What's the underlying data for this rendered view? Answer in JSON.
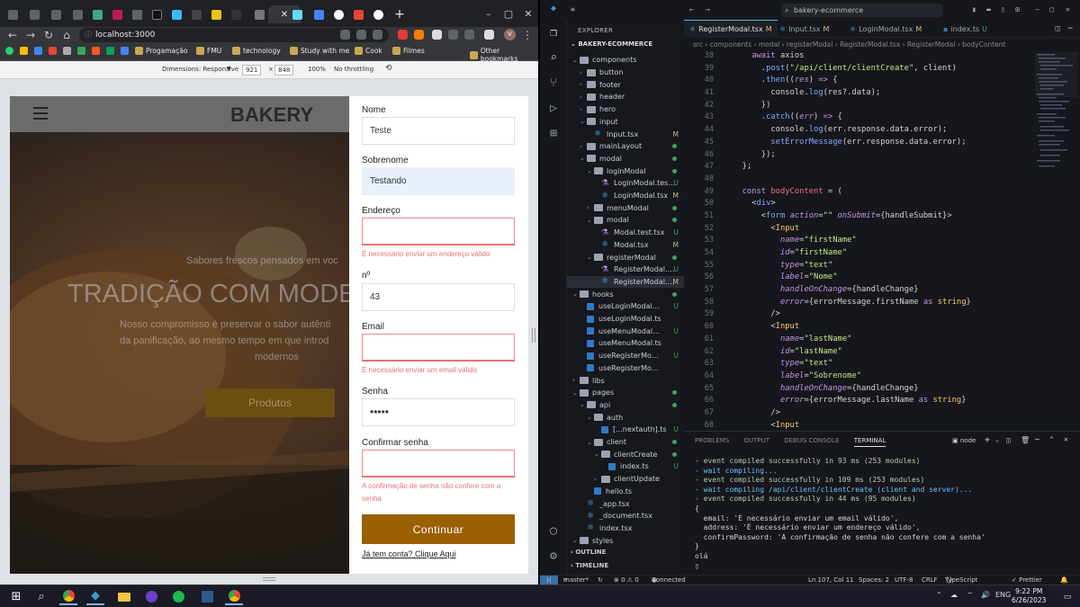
{
  "browser": {
    "url": "localhost:3000",
    "bookmarks": [
      "Progamação",
      "FMU",
      "technology",
      "Study with me",
      "Cook",
      "Filmes",
      "Other bookmarks"
    ],
    "devtools": {
      "dimensions_label": "Dimensions: Responsive",
      "width": "921",
      "times": "×",
      "height": "848",
      "zoom": "100%",
      "throttle": "No throttling"
    },
    "avatar_letter": "V"
  },
  "site": {
    "logo": "BAKERY",
    "hero_subtitle": "Sabores frescos pensados em voc",
    "hero_title": "TRADIÇÃO COM MODE",
    "hero_text_1": "Nosso compromisso é preservar o sabor autênti",
    "hero_text_2": "da panificação, ao mesmo tempo em que introd",
    "hero_text_3": "modernos",
    "hero_button": "Produtos"
  },
  "form": {
    "nome_label": "Nome",
    "nome_value": "Teste",
    "sobrenome_label": "Sobrenome",
    "sobrenome_value": "Testando",
    "endereco_label": "Endereço",
    "endereco_error": "É necessário enviar um endereço válido",
    "numero_label": "nº",
    "numero_value": "43",
    "email_label": "Email",
    "email_error": "É necessário enviar um email válido",
    "senha_label": "Senha",
    "senha_value": "•••••",
    "confirmar_label": "Confirmar senha",
    "confirmar_error": "A confirmação de senha não confere com a senha",
    "submit": "Continuar",
    "login_link": "Já tem conta? Clique Aqui"
  },
  "vscode": {
    "search": "bakery-ecommerce",
    "explorer_title": "EXPLORER",
    "project": "BAKERY-ECOMMERCE",
    "tree": [
      {
        "label": "components",
        "indent": 1,
        "kind": "folder",
        "open": true
      },
      {
        "label": "button",
        "indent": 2,
        "kind": "folder",
        "open": false
      },
      {
        "label": "footer",
        "indent": 2,
        "kind": "folder",
        "open": false
      },
      {
        "label": "header",
        "indent": 2,
        "kind": "folder",
        "open": false
      },
      {
        "label": "hero",
        "indent": 2,
        "kind": "folder",
        "open": false
      },
      {
        "label": "input",
        "indent": 2,
        "kind": "folder",
        "open": true
      },
      {
        "label": "Input.tsx",
        "indent": 3,
        "kind": "react",
        "status": "M"
      },
      {
        "label": "mainLayout",
        "indent": 2,
        "kind": "folder",
        "open": false,
        "dot": true
      },
      {
        "label": "modal",
        "indent": 2,
        "kind": "folder",
        "open": true,
        "dot": true
      },
      {
        "label": "loginModal",
        "indent": 3,
        "kind": "folder",
        "open": true,
        "dot": true
      },
      {
        "label": "LoginModal.test.tsx",
        "indent": 4,
        "kind": "test",
        "status": "U"
      },
      {
        "label": "LoginModal.tsx",
        "indent": 4,
        "kind": "react",
        "status": "M"
      },
      {
        "label": "menuModal",
        "indent": 3,
        "kind": "folder",
        "open": false,
        "dot": true
      },
      {
        "label": "modal",
        "indent": 3,
        "kind": "folder",
        "open": true,
        "dot": true
      },
      {
        "label": "Modal.test.tsx",
        "indent": 4,
        "kind": "test",
        "status": "U"
      },
      {
        "label": "Modal.tsx",
        "indent": 4,
        "kind": "react",
        "status": "M"
      },
      {
        "label": "registerModal",
        "indent": 3,
        "kind": "folder",
        "open": true,
        "dot": true
      },
      {
        "label": "RegisterModal.test.tsx",
        "indent": 4,
        "kind": "test",
        "status": "U"
      },
      {
        "label": "RegisterModal.tsx",
        "indent": 4,
        "kind": "react",
        "status": "M",
        "selected": true
      },
      {
        "label": "hooks",
        "indent": 1,
        "kind": "folder",
        "open": true,
        "dot": true
      },
      {
        "label": "useLoginModal.test.ts",
        "indent": 2,
        "kind": "ts",
        "status": "U"
      },
      {
        "label": "useLoginModal.ts",
        "indent": 2,
        "kind": "ts"
      },
      {
        "label": "useMenuModal.test.ts",
        "indent": 2,
        "kind": "ts",
        "status": "U"
      },
      {
        "label": "useMenuModal.ts",
        "indent": 2,
        "kind": "ts"
      },
      {
        "label": "useRegisterModal.test.ts",
        "indent": 2,
        "kind": "ts",
        "status": "U"
      },
      {
        "label": "useRegisterModal.ts",
        "indent": 2,
        "kind": "ts"
      },
      {
        "label": "libs",
        "indent": 1,
        "kind": "folder",
        "open": false
      },
      {
        "label": "pages",
        "indent": 1,
        "kind": "folder",
        "open": true,
        "dot": true
      },
      {
        "label": "api",
        "indent": 2,
        "kind": "folder",
        "open": true,
        "dot": true
      },
      {
        "label": "auth",
        "indent": 3,
        "kind": "folder",
        "open": true
      },
      {
        "label": "[...nextauth].ts",
        "indent": 4,
        "kind": "ts",
        "status": "U"
      },
      {
        "label": "client",
        "indent": 3,
        "kind": "folder",
        "open": true,
        "dot": true
      },
      {
        "label": "clientCreate",
        "indent": 4,
        "kind": "folder",
        "open": true,
        "dot": true
      },
      {
        "label": "index.ts",
        "indent": 5,
        "kind": "ts",
        "status": "U"
      },
      {
        "label": "clientUpdate",
        "indent": 4,
        "kind": "folder",
        "open": false
      },
      {
        "label": "hello.ts",
        "indent": 3,
        "kind": "ts"
      },
      {
        "label": "_app.tsx",
        "indent": 2,
        "kind": "react"
      },
      {
        "label": "_document.tsx",
        "indent": 2,
        "kind": "react"
      },
      {
        "label": "index.tsx",
        "indent": 2,
        "kind": "react"
      },
      {
        "label": "styles",
        "indent": 1,
        "kind": "folder",
        "open": true
      }
    ],
    "outline": "OUTLINE",
    "timeline": "TIMELINE",
    "tabs": [
      {
        "label": "RegisterModal.tsx",
        "status": "M",
        "active": true
      },
      {
        "label": "Input.tsx",
        "status": "M"
      },
      {
        "label": "LoginModal.tsx",
        "status": "M"
      },
      {
        "label": "index.ts",
        "status": "U"
      }
    ],
    "breadcrumb": "src › components › modal › registerModal › RegisterModal.tsx › RegisterModal › bodyContent",
    "code_start": 38,
    "code": [
      [
        [
          "pl",
          "    "
        ],
        [
          "kw",
          "await "
        ],
        [
          "pl",
          "axios"
        ]
      ],
      [
        [
          "pl",
          "      ."
        ],
        [
          "fn",
          "post"
        ],
        [
          "pl",
          "("
        ],
        [
          "str",
          "\"/api/client/clientCreate\""
        ],
        [
          "pl",
          ", client)"
        ]
      ],
      [
        [
          "pl",
          "      ."
        ],
        [
          "fn",
          "then"
        ],
        [
          "pl",
          "(("
        ],
        [
          "at",
          "res"
        ],
        [
          "pl",
          ") "
        ],
        [
          "kw",
          "=>"
        ],
        [
          "pl",
          " {"
        ]
      ],
      [
        [
          "pl",
          "        console."
        ],
        [
          "fn",
          "log"
        ],
        [
          "pl",
          "(res?.data);"
        ]
      ],
      [
        [
          "pl",
          "      })"
        ]
      ],
      [
        [
          "pl",
          "      ."
        ],
        [
          "fn",
          "catch"
        ],
        [
          "pl",
          "(("
        ],
        [
          "at",
          "err"
        ],
        [
          "pl",
          ") "
        ],
        [
          "kw",
          "=>"
        ],
        [
          "pl",
          " {"
        ]
      ],
      [
        [
          "pl",
          "        console."
        ],
        [
          "fn",
          "log"
        ],
        [
          "pl",
          "(err.response.data.error);"
        ]
      ],
      [
        [
          "pl",
          "        "
        ],
        [
          "fn",
          "setErrorMessage"
        ],
        [
          "pl",
          "(err.response.data.error);"
        ]
      ],
      [
        [
          "pl",
          "      });"
        ]
      ],
      [
        [
          "pl",
          "  };"
        ]
      ],
      [
        [
          "pl",
          ""
        ]
      ],
      [
        [
          "kw",
          "  const "
        ],
        [
          "vr",
          "bodyContent"
        ],
        [
          "pl",
          " = ("
        ]
      ],
      [
        [
          "pl",
          "    <"
        ],
        [
          "tg",
          "div"
        ],
        [
          "pl",
          ">"
        ]
      ],
      [
        [
          "pl",
          "      <"
        ],
        [
          "tg",
          "form "
        ],
        [
          "at",
          "action"
        ],
        [
          "pl",
          "="
        ],
        [
          "str",
          "\"\" "
        ],
        [
          "at",
          "onSubmit"
        ],
        [
          "pl",
          "={handleSubmit}>"
        ]
      ],
      [
        [
          "pl",
          "        <"
        ],
        [
          "ty",
          "Input"
        ]
      ],
      [
        [
          "at",
          "          name"
        ],
        [
          "pl",
          "="
        ],
        [
          "str",
          "\"firstName\""
        ]
      ],
      [
        [
          "at",
          "          id"
        ],
        [
          "pl",
          "="
        ],
        [
          "str",
          "\"firstName\""
        ]
      ],
      [
        [
          "at",
          "          type"
        ],
        [
          "pl",
          "="
        ],
        [
          "str",
          "\"text\""
        ]
      ],
      [
        [
          "at",
          "          label"
        ],
        [
          "pl",
          "="
        ],
        [
          "str",
          "\"Nome\""
        ]
      ],
      [
        [
          "at",
          "          handleOnChange"
        ],
        [
          "pl",
          "={handleChange}"
        ]
      ],
      [
        [
          "at",
          "          error"
        ],
        [
          "pl",
          "={errorMessage.firstName "
        ],
        [
          "kw",
          "as "
        ],
        [
          "ty",
          "string"
        ],
        [
          "pl",
          "}"
        ]
      ],
      [
        [
          "pl",
          "        />"
        ]
      ],
      [
        [
          "pl",
          "        <"
        ],
        [
          "ty",
          "Input"
        ]
      ],
      [
        [
          "at",
          "          name"
        ],
        [
          "pl",
          "="
        ],
        [
          "str",
          "\"lastName\""
        ]
      ],
      [
        [
          "at",
          "          id"
        ],
        [
          "pl",
          "="
        ],
        [
          "str",
          "\"lastName\""
        ]
      ],
      [
        [
          "at",
          "          type"
        ],
        [
          "pl",
          "="
        ],
        [
          "str",
          "\"text\""
        ]
      ],
      [
        [
          "at",
          "          label"
        ],
        [
          "pl",
          "="
        ],
        [
          "str",
          "\"Sobrenome\""
        ]
      ],
      [
        [
          "at",
          "          handleOnChange"
        ],
        [
          "pl",
          "={handleChange}"
        ]
      ],
      [
        [
          "at",
          "          error"
        ],
        [
          "pl",
          "={errorMessage.lastName "
        ],
        [
          "kw",
          "as "
        ],
        [
          "ty",
          "string"
        ],
        [
          "pl",
          "}"
        ]
      ],
      [
        [
          "pl",
          "        />"
        ]
      ],
      [
        [
          "pl",
          "        <"
        ],
        [
          "ty",
          "Input"
        ]
      ]
    ],
    "panel_tabs": [
      "PROBLEMS",
      "OUTPUT",
      "DEBUG CONSOLE",
      "TERMINAL"
    ],
    "terminal_shell": "node",
    "terminal": [
      "- event compiled successfully in 93 ms (253 modules)",
      "- wait compiling...",
      "- event compiled successfully in 109 ms (253 modules)",
      "- wait compiling /api/client/clientCreate (client and server)...",
      "- event compiled successfully in 44 ms (95 modules)",
      "{",
      "  email: 'É necessário enviar um email válido',",
      "  address: 'É necessário enviar um endereço válido',",
      "  confirmPassword: 'A confirmação de senha não confere com a senha'",
      "}",
      "olá",
      "▯"
    ],
    "status": {
      "branch": "master*",
      "problems": "⊗ 0 ⚠ 0",
      "discord": "Connected to Discord",
      "position": "Ln 107, Col 11",
      "spaces": "Spaces: 2",
      "encoding": "UTF-8",
      "eol": "CRLF",
      "language": "TypeScript JSX",
      "prettier": "✓ Prettier"
    }
  },
  "taskbar": {
    "lang": "ENG",
    "time": "9:22 PM",
    "date": "6/26/2023"
  }
}
